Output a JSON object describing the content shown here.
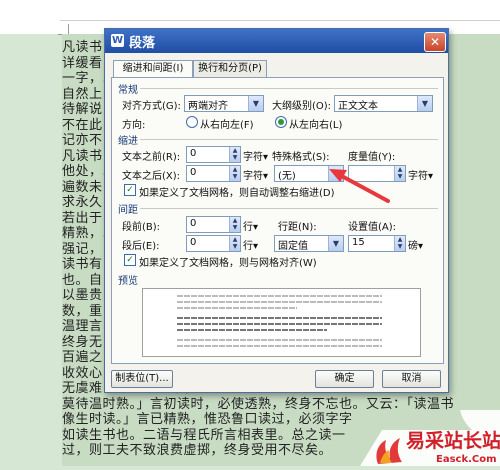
{
  "background_document": {
    "lines": [
      "凡读书 ... ... 书册，",
      "详缓看 ... ... 不可少",
      "一字，... ... 遍数，",
      "自然上 ... ... 读则不",
      "待解说 ... ... 到，心",
      "不在此 ... ... 能记，",
      "记亦不 ... ... 乎！",
      "凡读书 ... ... 得目视",
      "他处，... ... 成诵；",
      "遍数未 ... ... 理，以",
      "求永久 ... ... 其言皆",
      "若出于 ... ... 如未",
      "精熟，... ... ；含糊",
      "强记，",
      "读书有 ... ... 有得者",
      "也。自 ... ... 可以记",
      "以墨贵 ... ... 多读",
      "数，重 ... ... 无以",
      "温理言 ... ... 尽矜，",
      "终身无 ... ... 不知",
      "百遍之 ... ... 亦",
      "收效心 ... ... 于熟，",
      "无虞难 ... ... 读生书，",
      "莫待温时熟。」言初读时，必使透熟，终身不忘也。又云：「读温书",
      "像生时读。」言已精熟，惟恐鲁口读过，必须字字",
      "如读生书也。二语与程氏所言相表里。总之读一",
      "过，则工夫不致浪费虚掷，终身受用不尽矣。"
    ]
  },
  "dialog": {
    "app_logo": "W",
    "title": "段落",
    "tabs": [
      "缩进和间距(I)",
      "换行和分页(P)"
    ],
    "general": {
      "heading": "常规",
      "align_label": "对齐方式(G):",
      "align_value": "两端对齐",
      "outline_label": "大纲级别(O):",
      "outline_value": "正文文本",
      "direction_label": "方向:",
      "rtl_label": "从右向左(F)",
      "ltr_label": "从左向右(L)",
      "direction_selected": "ltr"
    },
    "indent": {
      "heading": "缩进",
      "before_label": "文本之前(R):",
      "before_value": "0",
      "before_unit": "字符▾",
      "after_label": "文本之后(X):",
      "after_value": "0",
      "after_unit": "字符▾",
      "special_label": "特殊格式(S):",
      "special_value": "(无)",
      "measure_label": "度量值(Y):",
      "measure_value": "",
      "measure_unit": "字符▾",
      "auto_adjust_label": "如果定义了文档网格，则自动调整右缩进(D)",
      "auto_adjust_checked": true
    },
    "spacing": {
      "heading": "间距",
      "before_label": "段前(B):",
      "before_value": "0",
      "before_unit": "行▾",
      "after_label": "段后(E):",
      "after_value": "0",
      "after_unit": "行▾",
      "line_label": "行距(N):",
      "line_value": "固定值",
      "setting_label": "设置值(A):",
      "setting_value": "15",
      "setting_unit": "磅▾",
      "snap_grid_label": "如果定义了文档网格，则与网格对齐(W)",
      "snap_grid_checked": true
    },
    "preview": {
      "heading": "预览"
    },
    "buttons": {
      "tabs": "制表位(T)...",
      "ok": "确定",
      "cancel": "取消"
    }
  },
  "watermark": {
    "brand": "易采站长站",
    "domain": "Easck.Com"
  },
  "colors": {
    "title_bar": "#1f4ea3",
    "dialog_bg": "#f4f2ec",
    "page_bg": "#c8dcc4",
    "arrow": "#e8383d",
    "section_heading": "#1a3c78"
  }
}
